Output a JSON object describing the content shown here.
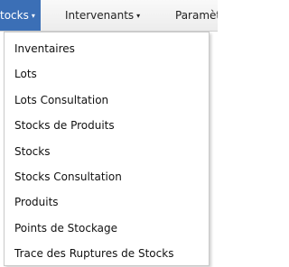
{
  "menubar": {
    "items": [
      {
        "label": "tocks"
      },
      {
        "label": "Intervenants"
      },
      {
        "label": "Paramèt"
      }
    ],
    "caret": "▾"
  },
  "dropdown": {
    "items": [
      {
        "label": "Inventaires"
      },
      {
        "label": "Lots"
      },
      {
        "label": "Lots Consultation"
      },
      {
        "label": "Stocks de Produits"
      },
      {
        "label": "Stocks"
      },
      {
        "label": "Stocks Consultation"
      },
      {
        "label": "Produits"
      },
      {
        "label": "Points de Stockage"
      },
      {
        "label": "Trace des Ruptures de Stocks"
      }
    ]
  },
  "colors": {
    "active_menu": "#3b6fb6",
    "menubar_bg": "#f1f1f1",
    "dropdown_bg": "#ffffff"
  }
}
